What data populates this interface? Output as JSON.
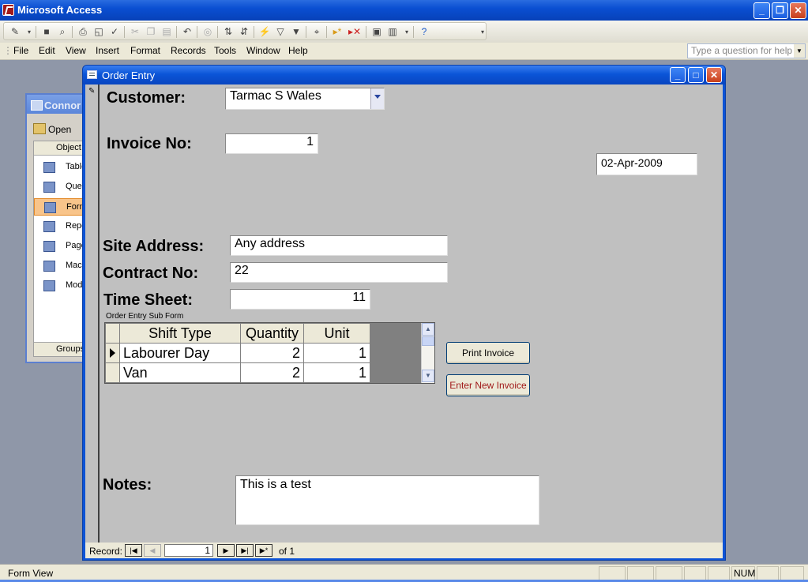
{
  "app": {
    "title": "Microsoft Access"
  },
  "menu": [
    "File",
    "Edit",
    "View",
    "Insert",
    "Format",
    "Records",
    "Tools",
    "Window",
    "Help"
  ],
  "help": {
    "placeholder": "Type a question for help"
  },
  "db_window": {
    "title": "Connor",
    "open_label": "Open",
    "objects_header": "Object",
    "objects": [
      "Table",
      "Quer",
      "Form",
      "Repo",
      "Page",
      "Macr",
      "Modu"
    ],
    "groups_label": "Groups"
  },
  "form": {
    "title": "Order Entry",
    "customer_label": "Customer:",
    "customer_value": "Tarmac S Wales",
    "invoice_label": "Invoice No:",
    "invoice_value": "1",
    "date_value": "02-Apr-2009",
    "site_label": "Site Address:",
    "site_value": "Any address",
    "contract_label": "Contract No:",
    "contract_value": "22",
    "timesheet_label": "Time Sheet:",
    "timesheet_value": "11",
    "subform_label": "Order Entry Sub Form",
    "subform": {
      "columns": [
        "Shift Type",
        "Quantity",
        "Unit"
      ],
      "rows": [
        {
          "shift": "Labourer Day",
          "qty": "2",
          "unit": "1"
        },
        {
          "shift": "Van",
          "qty": "2",
          "unit": "1"
        }
      ]
    },
    "print_btn": "Print Invoice",
    "new_btn": "Enter New Invoice",
    "notes_label": "Notes:",
    "notes_value": "This is a test"
  },
  "record_nav": {
    "label": "Record:",
    "current": "1",
    "of": "of 1"
  },
  "status": {
    "left": "Form View",
    "num": "NUM"
  }
}
